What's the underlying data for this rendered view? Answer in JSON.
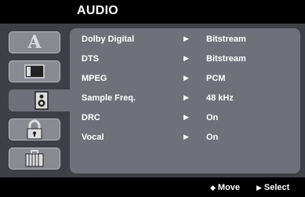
{
  "header": {
    "title": "AUDIO"
  },
  "tabs": [
    {
      "label": "A",
      "icon": "language-icon"
    },
    {
      "label": "",
      "icon": "display-icon"
    },
    {
      "label": "",
      "icon": "speaker-icon"
    },
    {
      "label": "",
      "icon": "lock-icon"
    },
    {
      "label": "",
      "icon": "toolbox-icon"
    }
  ],
  "settings": [
    {
      "label": "Dolby Digital",
      "arrow": "▶",
      "value": "Bitstream"
    },
    {
      "label": "DTS",
      "arrow": "▶",
      "value": "Bitstream"
    },
    {
      "label": "MPEG",
      "arrow": "▶",
      "value": "PCM"
    },
    {
      "label": "Sample Freq.",
      "arrow": "▶",
      "value": "48 kHz"
    },
    {
      "label": "DRC",
      "arrow": "▶",
      "value": "On"
    },
    {
      "label": "Vocal",
      "arrow": "▶",
      "value": "On"
    }
  ],
  "footer": {
    "move": {
      "glyph": "◆",
      "label": "Move"
    },
    "select": {
      "glyph": "▶",
      "label": "Select"
    }
  },
  "colors": {
    "frame": "#3f3f46",
    "panel": "#70707a",
    "tab": "#8a8a92",
    "text": "#ffffff"
  }
}
